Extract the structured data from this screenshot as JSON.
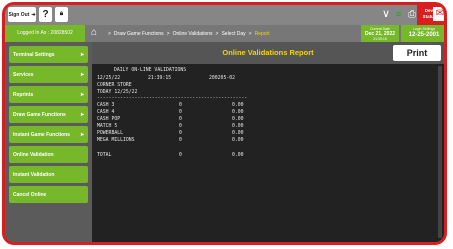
{
  "topbar": {
    "signout_label": "Sign Out",
    "signout_icon": "sign-out-icon",
    "help_label": "?",
    "lock_icon": "lock-icon",
    "dropdown_icon": "chevron-down-icon",
    "queue_icon": "queue-icon",
    "printer_icon": "printer-icon",
    "device_status_line1": "Device",
    "device_status_line2": "Statuses",
    "mail_icon": "mail-icon"
  },
  "secondbar": {
    "logged_in": "Logged In As : 20828502",
    "breadcrumb": [
      "Draw Game Functions",
      "Online Validations",
      "Select Day",
      "Report"
    ],
    "current_date_label": "Current Date",
    "current_date_value": "Dec 21, 2022",
    "current_time_value": "21:39:15",
    "login_date_label": "Login Settings",
    "login_date_value": "12-25-2001"
  },
  "sidebar": {
    "items": [
      {
        "label": "Terminal Settings",
        "chevron": true
      },
      {
        "label": "Services",
        "chevron": true
      },
      {
        "label": "Reprints",
        "chevron": true
      },
      {
        "label": "Draw Game Functions",
        "chevron": true
      },
      {
        "label": "Instant Game Functions",
        "chevron": true
      },
      {
        "label": "Online Validation",
        "chevron": false
      },
      {
        "label": "Instant Validation",
        "chevron": false
      },
      {
        "label": "Cancel Online",
        "chevron": false
      }
    ]
  },
  "report": {
    "title": "Online Validations Report",
    "print_label": "Print",
    "lines": {
      "heading": "DAILY ON-LINE VALIDATIONS",
      "date": "12/25/22",
      "time": "21:39:15",
      "id": "200205-02",
      "store": "CORNER STORE",
      "today": "TODAY 12/25/22",
      "divider": "----------------------------------------------------",
      "rows": [
        {
          "name": "CASH 3",
          "count": "0",
          "amount": "0.00"
        },
        {
          "name": "CASH 4",
          "count": "0",
          "amount": "0.00"
        },
        {
          "name": "CASH POP",
          "count": "0",
          "amount": "0.00"
        },
        {
          "name": "MATCH 5",
          "count": "0",
          "amount": "0.00"
        },
        {
          "name": "POWERBALL",
          "count": "0",
          "amount": "0.00"
        },
        {
          "name": "MEGA MILLIONS",
          "count": "0",
          "amount": "0.00"
        }
      ],
      "total": {
        "name": "TOTAL",
        "count": "0",
        "amount": "0.00"
      }
    }
  }
}
